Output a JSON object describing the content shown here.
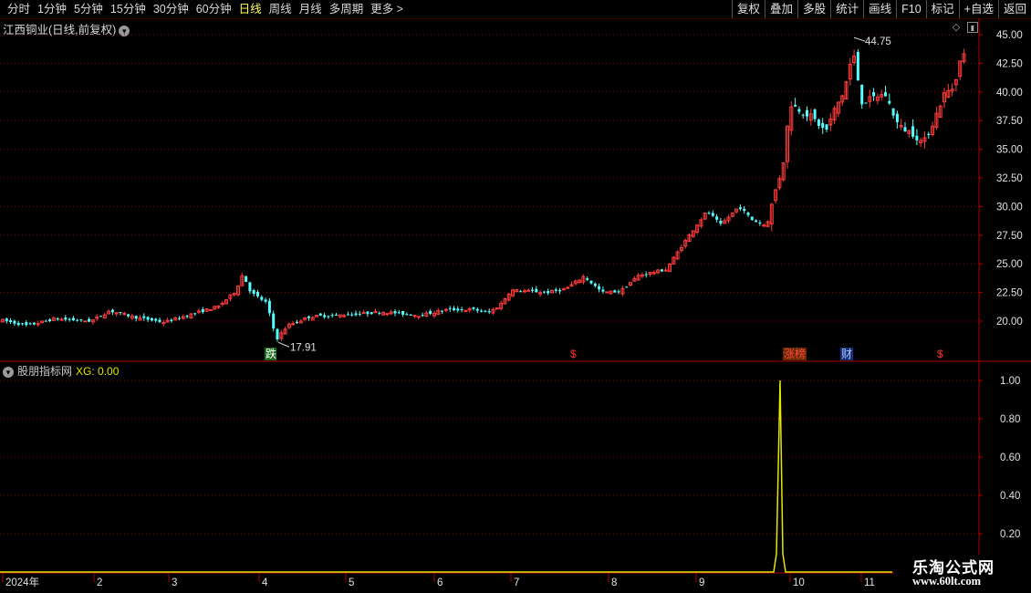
{
  "toolbar": {
    "left_items": [
      "分时",
      "1分钟",
      "5分钟",
      "15分钟",
      "30分钟",
      "60分钟",
      "日线",
      "周线",
      "月线",
      "多周期",
      "更多 >"
    ],
    "active_item": "日线",
    "right_buttons": [
      "复权",
      "叠加",
      "多股",
      "统计",
      "画线",
      "F10",
      "标记",
      "+自选",
      "返回"
    ]
  },
  "main_chart": {
    "title": "江西铜业(日线,前复权)",
    "price_axis_ticks": [
      "45.00",
      "42.50",
      "40.00",
      "37.50",
      "35.00",
      "32.50",
      "30.00",
      "27.50",
      "25.00",
      "22.50",
      "20.00"
    ],
    "high_label": "44.75",
    "low_label": "17.91",
    "event_markers": [
      {
        "text": "跌",
        "color": "#33aa33"
      },
      {
        "text": "$",
        "color": "#ff3333"
      },
      {
        "text": "涨榜",
        "color": "#ff4444"
      },
      {
        "text": "财",
        "color": "#3366ff"
      },
      {
        "text": "$",
        "color": "#ff3333"
      }
    ]
  },
  "indicator": {
    "title": "股朋指标网",
    "xg_label": "XG: 0.00",
    "axis_ticks": [
      "1.00",
      "0.80",
      "0.60",
      "0.40",
      "0.20"
    ]
  },
  "date_axis": {
    "labels": [
      "2024年",
      "2",
      "3",
      "4",
      "5",
      "6",
      "7",
      "8",
      "9",
      "10",
      "11"
    ]
  },
  "colors": {
    "up": "#ff3b3b",
    "down": "#54ffff",
    "grid": "#8a0000",
    "indicator_line": "#e6e600"
  },
  "watermark": {
    "line1": "乐淘公式网",
    "line2": "www.60lt.com"
  },
  "chart_data": {
    "type": "candlestick",
    "price_range": [
      17.91,
      44.75
    ],
    "indicator_range": [
      0,
      1
    ],
    "xg_signal": {
      "month": "10",
      "value": 1.0
    }
  }
}
